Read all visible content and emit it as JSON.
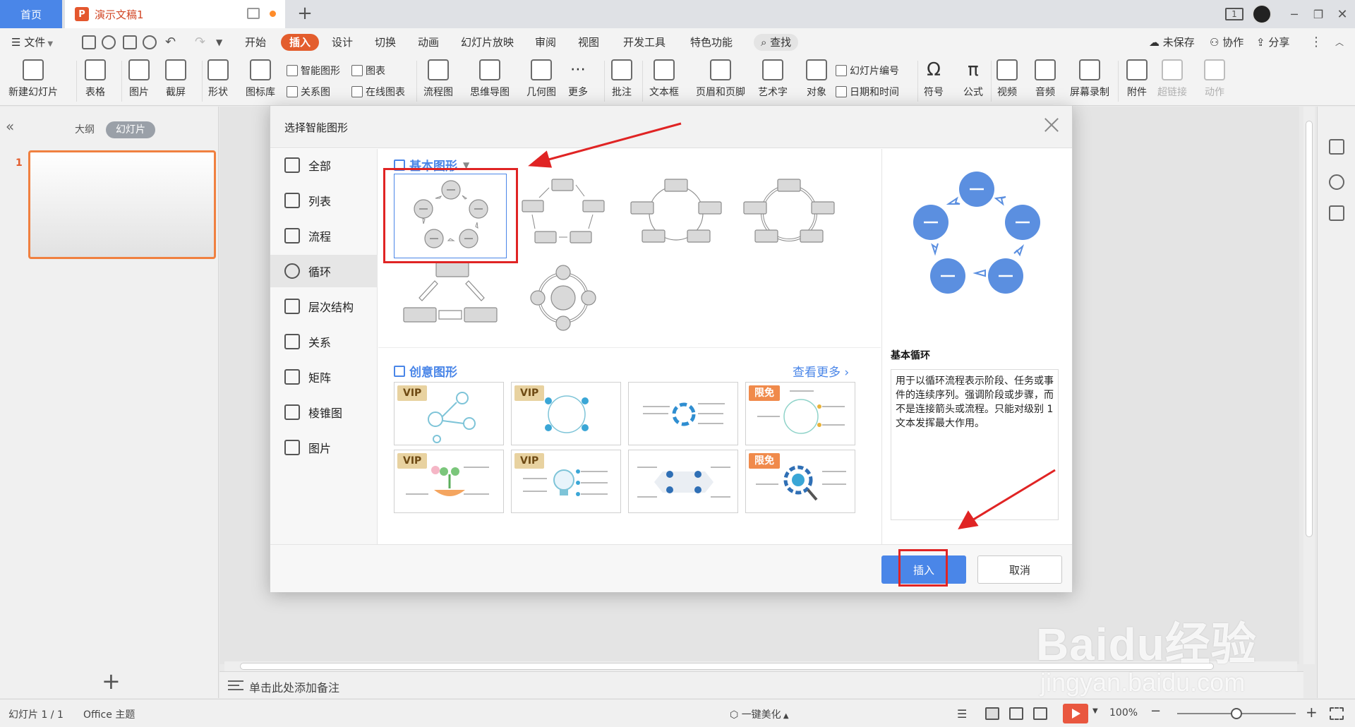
{
  "tabs": {
    "home": "首页",
    "document": "演示文稿1",
    "page_badge": "1"
  },
  "menu": {
    "file": "文件",
    "items": [
      "开始",
      "插入",
      "设计",
      "切换",
      "动画",
      "幻灯片放映",
      "审阅",
      "视图",
      "开发工具",
      "特色功能"
    ],
    "active": "插入",
    "search": "查找",
    "unsaved": "未保存",
    "collaborate": "协作",
    "share": "分享"
  },
  "ribbon": {
    "new_slide": "新建幻灯片",
    "table": "表格",
    "picture": "图片",
    "screenshot": "截屏",
    "shape": "形状",
    "icon_lib": "图标库",
    "smartart": "智能图形",
    "chart": "图表",
    "relation": "关系图",
    "online_chart": "在线图表",
    "flowchart": "流程图",
    "mindmap": "思维导图",
    "geometry": "几何图",
    "more": "更多",
    "comment": "批注",
    "textbox": "文本框",
    "header_footer": "页眉和页脚",
    "wordart": "艺术字",
    "object": "对象",
    "slide_number": "幻灯片编号",
    "datetime": "日期和时间",
    "symbol": "符号",
    "formula": "公式",
    "video": "视频",
    "audio": "音频",
    "screen_record": "屏幕录制",
    "attachment": "附件",
    "hyperlink": "超链接",
    "action": "动作"
  },
  "left_panel": {
    "outline": "大纲",
    "slides": "幻灯片",
    "slide_index": "1"
  },
  "notes": "单击此处添加备注",
  "status": {
    "slide_info": "幻灯片 1 / 1",
    "theme": "Office 主题",
    "beautify": "一键美化",
    "zoom": "100%",
    "zoom_level_percent": 100
  },
  "dialog": {
    "title": "选择智能图形",
    "categories": [
      "全部",
      "列表",
      "流程",
      "循环",
      "层次结构",
      "关系",
      "矩阵",
      "棱锥图",
      "图片"
    ],
    "active_category": "循环",
    "basic_section": "基本图形",
    "creative_section": "创意图形",
    "see_more": "查看更多",
    "creative_badges": [
      "VIP",
      "VIP",
      "",
      "限免",
      "VIP",
      "VIP",
      "",
      "限免"
    ],
    "preview_name": "基本循环",
    "preview_desc": "用于以循环流程表示阶段、任务或事件的连续序列。强调阶段或步骤，而不是连接箭头或流程。只能对级别 1 文本发挥最大作用。",
    "insert": "插入",
    "cancel": "取消"
  },
  "watermark": {
    "main": "Baidu经验",
    "sub": "jingyan.baidu.com"
  },
  "colors": {
    "accent": "#4a86e8",
    "brand_orange": "#e35d2d",
    "annotation_red": "#e02424",
    "preview_circle": "#5b8fe0"
  }
}
